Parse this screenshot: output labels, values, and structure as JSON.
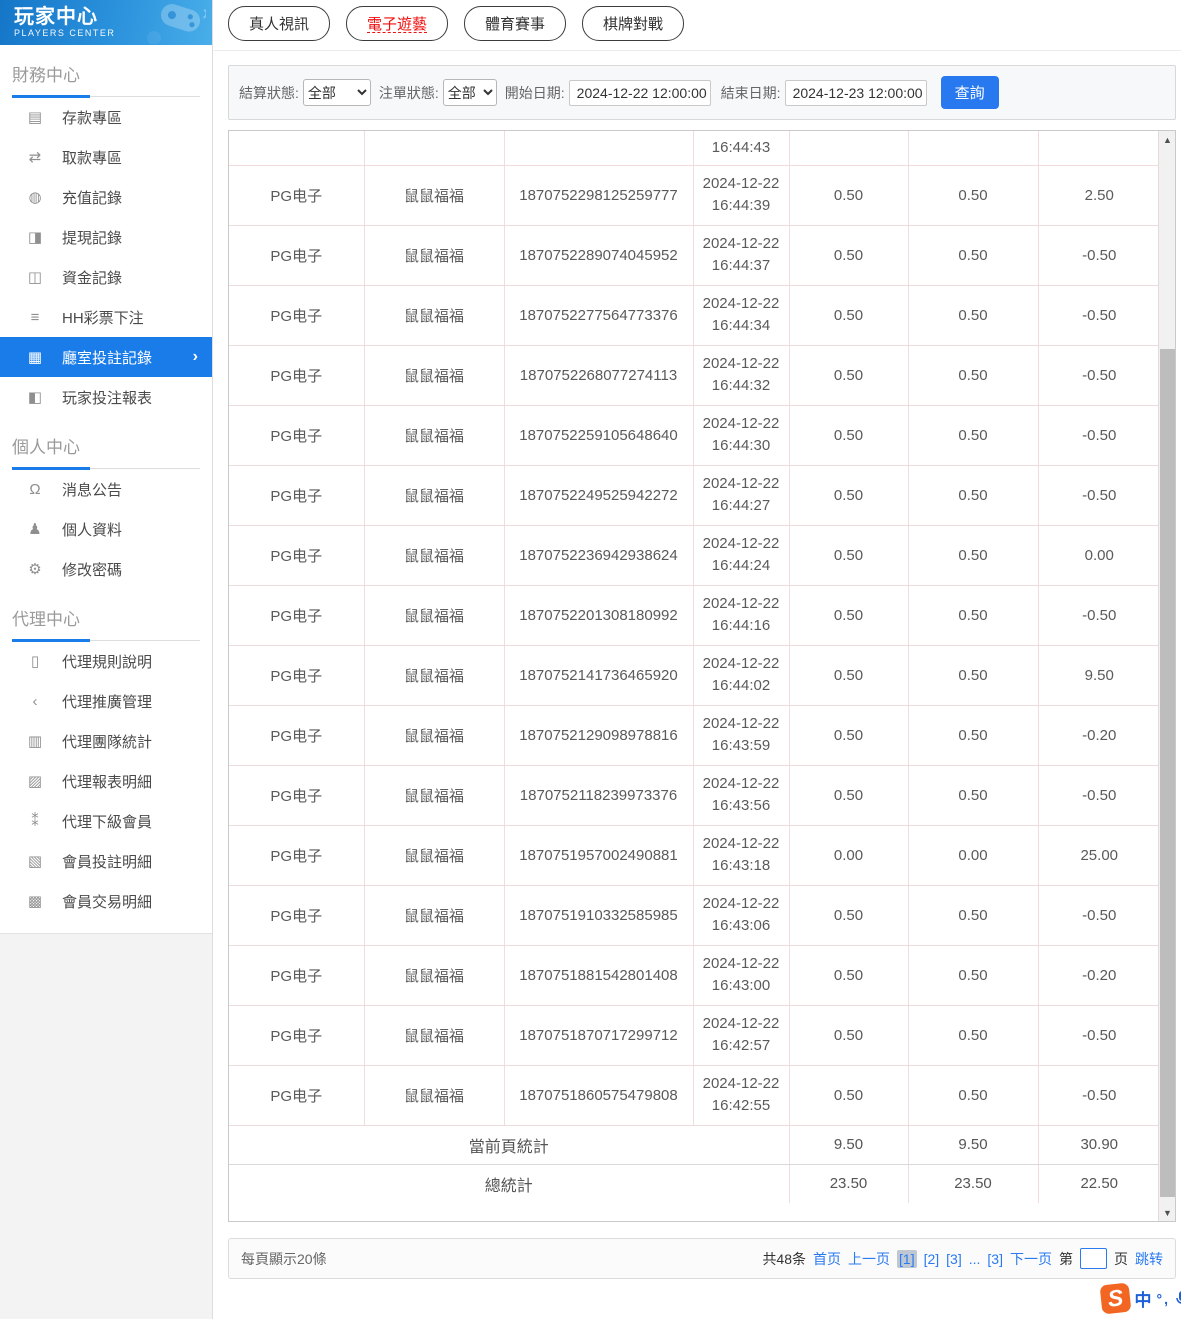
{
  "app": {
    "title": "玩家中心",
    "subtitle": "PLAYERS CENTER"
  },
  "sidebar": {
    "sections": [
      {
        "label": "財務中心",
        "items": [
          {
            "label": "存款專區",
            "icon": "deposit-card-icon"
          },
          {
            "label": "取款專區",
            "icon": "withdraw-hand-icon"
          },
          {
            "label": "充值記錄",
            "icon": "recharge-record-icon"
          },
          {
            "label": "提現記錄",
            "icon": "withdrawal-record-icon"
          },
          {
            "label": "資金記錄",
            "icon": "funds-record-icon"
          },
          {
            "label": "HH彩票下注",
            "icon": "lottery-bet-icon"
          },
          {
            "label": "廳室投註記錄",
            "icon": "room-bet-record-icon",
            "active": true
          },
          {
            "label": "玩家投注報表",
            "icon": "player-bet-report-icon"
          }
        ]
      },
      {
        "label": "個人中心",
        "items": [
          {
            "label": "消息公告",
            "icon": "announcement-bell-icon"
          },
          {
            "label": "個人資料",
            "icon": "profile-person-icon"
          },
          {
            "label": "修改密碼",
            "icon": "password-gear-icon"
          }
        ]
      },
      {
        "label": "代理中心",
        "items": [
          {
            "label": "代理規則說明",
            "icon": "agent-rules-doc-icon"
          },
          {
            "label": "代理推廣管理",
            "icon": "agent-promotion-share-icon"
          },
          {
            "label": "代理團隊統計",
            "icon": "agent-team-stats-icon"
          },
          {
            "label": "代理報表明細",
            "icon": "agent-report-detail-icon"
          },
          {
            "label": "代理下級會員",
            "icon": "agent-sub-members-icon"
          },
          {
            "label": "會員投註明細",
            "icon": "member-bet-detail-icon"
          },
          {
            "label": "會員交易明細",
            "icon": "member-transaction-detail-icon"
          }
        ]
      }
    ]
  },
  "tabs": [
    {
      "label": "真人視訊",
      "active": false
    },
    {
      "label": "電子遊藝",
      "active": true
    },
    {
      "label": "體育賽事",
      "active": false
    },
    {
      "label": "棋牌對戰",
      "active": false
    }
  ],
  "filters": {
    "settle_status_label": "結算狀態:",
    "settle_status_value": "全部",
    "order_status_label": "注單狀態:",
    "order_status_value": "全部",
    "start_label": "開始日期:",
    "start_value": "2024-12-22 12:00:00",
    "end_label": "結束日期:",
    "end_value": "2024-12-23 12:00:00",
    "search_label": "查詢"
  },
  "table": {
    "partial_row_time": "16:44:43",
    "rows": [
      {
        "platform": "PG电子",
        "player": "鼠鼠福福",
        "order_id": "1870752298125259777",
        "date": "2024-12-22",
        "time": "16:44:39",
        "bet": "0.50",
        "valid": "0.50",
        "result": "2.50"
      },
      {
        "platform": "PG电子",
        "player": "鼠鼠福福",
        "order_id": "1870752289074045952",
        "date": "2024-12-22",
        "time": "16:44:37",
        "bet": "0.50",
        "valid": "0.50",
        "result": "-0.50"
      },
      {
        "platform": "PG电子",
        "player": "鼠鼠福福",
        "order_id": "1870752277564773376",
        "date": "2024-12-22",
        "time": "16:44:34",
        "bet": "0.50",
        "valid": "0.50",
        "result": "-0.50"
      },
      {
        "platform": "PG电子",
        "player": "鼠鼠福福",
        "order_id": "1870752268077274113",
        "date": "2024-12-22",
        "time": "16:44:32",
        "bet": "0.50",
        "valid": "0.50",
        "result": "-0.50"
      },
      {
        "platform": "PG电子",
        "player": "鼠鼠福福",
        "order_id": "1870752259105648640",
        "date": "2024-12-22",
        "time": "16:44:30",
        "bet": "0.50",
        "valid": "0.50",
        "result": "-0.50"
      },
      {
        "platform": "PG电子",
        "player": "鼠鼠福福",
        "order_id": "1870752249525942272",
        "date": "2024-12-22",
        "time": "16:44:27",
        "bet": "0.50",
        "valid": "0.50",
        "result": "-0.50"
      },
      {
        "platform": "PG电子",
        "player": "鼠鼠福福",
        "order_id": "1870752236942938624",
        "date": "2024-12-22",
        "time": "16:44:24",
        "bet": "0.50",
        "valid": "0.50",
        "result": "0.00"
      },
      {
        "platform": "PG电子",
        "player": "鼠鼠福福",
        "order_id": "1870752201308180992",
        "date": "2024-12-22",
        "time": "16:44:16",
        "bet": "0.50",
        "valid": "0.50",
        "result": "-0.50"
      },
      {
        "platform": "PG电子",
        "player": "鼠鼠福福",
        "order_id": "1870752141736465920",
        "date": "2024-12-22",
        "time": "16:44:02",
        "bet": "0.50",
        "valid": "0.50",
        "result": "9.50"
      },
      {
        "platform": "PG电子",
        "player": "鼠鼠福福",
        "order_id": "1870752129098978816",
        "date": "2024-12-22",
        "time": "16:43:59",
        "bet": "0.50",
        "valid": "0.50",
        "result": "-0.20"
      },
      {
        "platform": "PG电子",
        "player": "鼠鼠福福",
        "order_id": "1870752118239973376",
        "date": "2024-12-22",
        "time": "16:43:56",
        "bet": "0.50",
        "valid": "0.50",
        "result": "-0.50"
      },
      {
        "platform": "PG电子",
        "player": "鼠鼠福福",
        "order_id": "1870751957002490881",
        "date": "2024-12-22",
        "time": "16:43:18",
        "bet": "0.00",
        "valid": "0.00",
        "result": "25.00"
      },
      {
        "platform": "PG电子",
        "player": "鼠鼠福福",
        "order_id": "1870751910332585985",
        "date": "2024-12-22",
        "time": "16:43:06",
        "bet": "0.50",
        "valid": "0.50",
        "result": "-0.50"
      },
      {
        "platform": "PG电子",
        "player": "鼠鼠福福",
        "order_id": "1870751881542801408",
        "date": "2024-12-22",
        "time": "16:43:00",
        "bet": "0.50",
        "valid": "0.50",
        "result": "-0.20"
      },
      {
        "platform": "PG电子",
        "player": "鼠鼠福福",
        "order_id": "1870751870717299712",
        "date": "2024-12-22",
        "time": "16:42:57",
        "bet": "0.50",
        "valid": "0.50",
        "result": "-0.50"
      },
      {
        "platform": "PG电子",
        "player": "鼠鼠福福",
        "order_id": "1870751860575479808",
        "date": "2024-12-22",
        "time": "16:42:55",
        "bet": "0.50",
        "valid": "0.50",
        "result": "-0.50"
      }
    ],
    "summary": [
      {
        "label": "當前頁統計",
        "bet": "9.50",
        "valid": "9.50",
        "result": "30.90"
      },
      {
        "label": "總統計",
        "bet": "23.50",
        "valid": "23.50",
        "result": "22.50"
      }
    ]
  },
  "pagination": {
    "page_size_text": "每頁顯示20條",
    "total_text": "共48条",
    "first_label": "首页",
    "prev_label": "上一页",
    "pages": [
      "[1]",
      "[2]",
      "[3]",
      "...",
      "[3]"
    ],
    "active_page_index": 0,
    "next_label": "下一页",
    "jump_prefix": "第",
    "jump_suffix": "页",
    "jump_action": "跳转"
  },
  "ime_overlay": {
    "logo": "S",
    "lang": "中",
    "symbols": "°,"
  },
  "colors": {
    "accent_blue": "#2878f0",
    "sidebar_active_blue": "#1a7ce8",
    "tab_active_red": "#f00f0f",
    "table_border_pink": "#f2dcdc",
    "header_gradient_left": "#1576c8",
    "header_gradient_right": "#49aee9"
  }
}
